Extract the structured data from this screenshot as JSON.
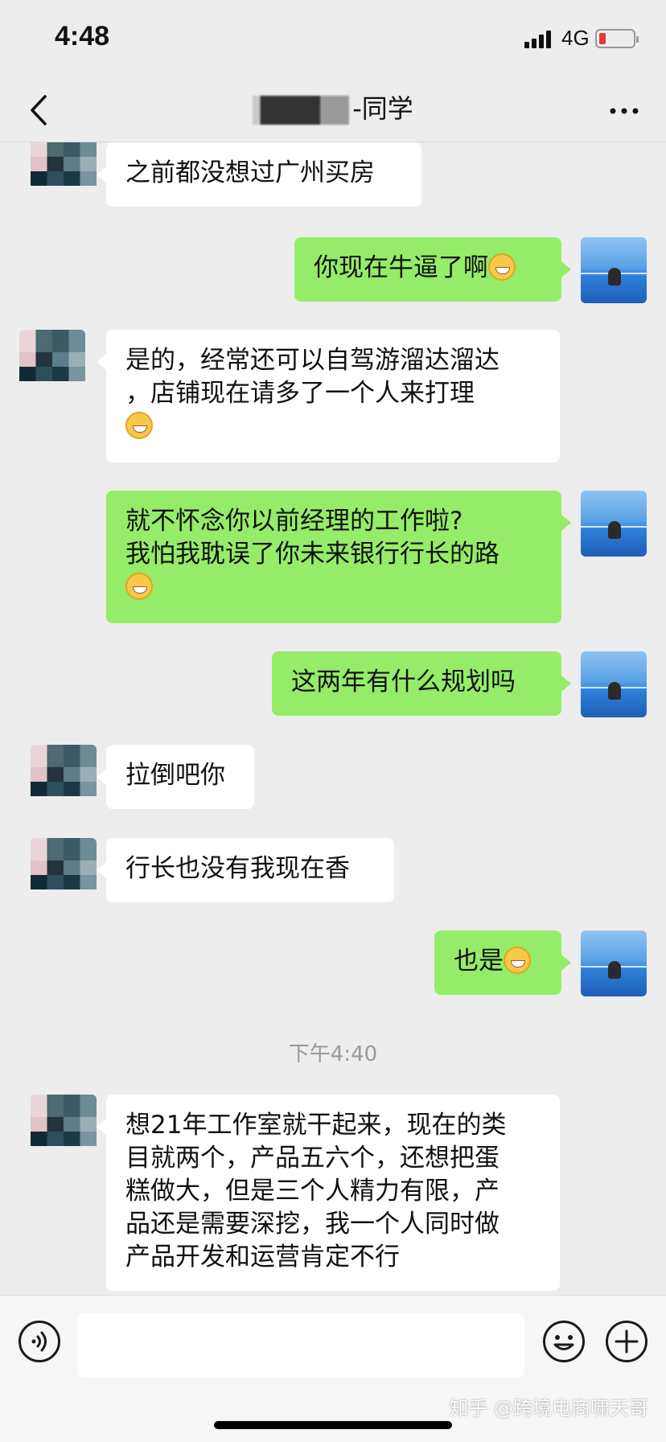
{
  "status_bar": {
    "time": "4:48",
    "network": "4G",
    "battery_level": 0.12,
    "battery_color": "#e53935"
  },
  "header": {
    "title": "-同学"
  },
  "chat": {
    "messages": [
      {
        "side": "in",
        "text": "之前都没想过广州买房"
      },
      {
        "side": "out",
        "text": "你现在牛逼了啊",
        "emoji": "grin-emoji"
      },
      {
        "side": "in",
        "line1": "是的，经常还可以自驾游溜达溜达",
        "line2": "，店铺现在请多了一个人来打理",
        "emoji": "squint-laugh-emoji"
      },
      {
        "side": "out",
        "line1": "就不怀念你以前经理的工作啦?",
        "line2": "我怕我耽误了你未来银行行长的路",
        "emoji": "grin-emoji"
      },
      {
        "side": "out",
        "text": "这两年有什么规划吗"
      },
      {
        "side": "in",
        "text": "拉倒吧你"
      },
      {
        "side": "in",
        "text": "行长也没有我现在香"
      },
      {
        "side": "out",
        "text": "也是",
        "emoji": "grin-emoji"
      },
      {
        "side": "in",
        "line1": "想21年工作室就干起来，现在的类",
        "line2": "目就两个，产品五六个，还想把蛋",
        "line3": "糕做大，但是三个人精力有限，产",
        "line4": "品还是需要深挖，我一个人同时做",
        "line5": "产品开发和运营肯定不行"
      }
    ],
    "timestamp": "下午4:40"
  },
  "input_bar": {
    "value": ""
  },
  "watermark": "知乎 @跨境电商啸天哥",
  "colors": {
    "background": "#ededed",
    "incoming_bubble": "#ffffff",
    "outgoing_bubble": "#95ec69",
    "timestamp": "#999999"
  }
}
